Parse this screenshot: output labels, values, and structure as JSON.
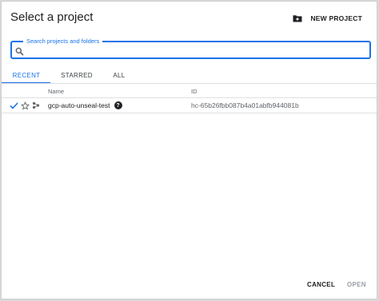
{
  "dialog": {
    "title": "Select a project",
    "new_project_label": "NEW PROJECT",
    "new_project_icon": "folder-add-icon"
  },
  "search": {
    "legend": "Search projects and folders",
    "value": "",
    "placeholder": ""
  },
  "tabs": [
    {
      "label": "RECENT",
      "active": true
    },
    {
      "label": "STARRED",
      "active": false
    },
    {
      "label": "ALL",
      "active": false
    }
  ],
  "table": {
    "columns": [
      "Name",
      "ID"
    ],
    "rows": [
      {
        "selected": true,
        "starred": false,
        "type_icon": "project-icon",
        "name": "gcp-auto-unseal-test",
        "help_icon": "?",
        "id": "hc-65b26fbb087b4a01abfb944081b"
      }
    ]
  },
  "footer": {
    "cancel_label": "CANCEL",
    "open_label": "OPEN"
  },
  "colors": {
    "accent": "#1a73e8",
    "disabled": "#9aa0a6"
  }
}
